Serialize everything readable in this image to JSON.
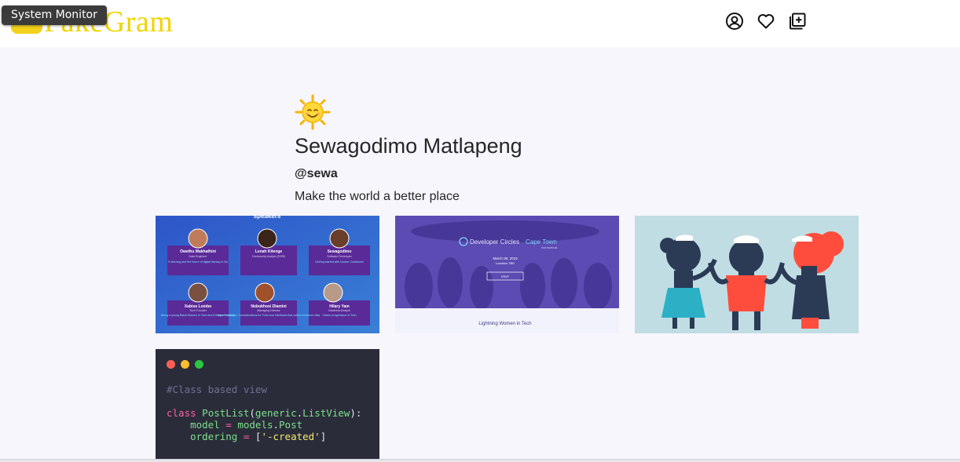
{
  "app": {
    "logo_text": "FakeGram",
    "tooltip": "System Monitor"
  },
  "nav": {
    "icons": [
      "user-circle-icon",
      "heart-icon",
      "add-post-icon"
    ]
  },
  "profile": {
    "avatar_icon": "sun-emoji-icon",
    "name": "Sewagodimo Matlapeng",
    "handle": "@sewa",
    "bio": "Make the world a better place"
  },
  "posts": {
    "speakers": {
      "heading": "speakers",
      "people": [
        {
          "name": "Owethu Makhathini",
          "role": "Data Engineer",
          "talk": "E-learning and the future of digital literacy in SA"
        },
        {
          "name": "Lenah Kitenge",
          "role": "Community Analyst (ESRI)",
          "talk": ""
        },
        {
          "name": "Sewagodimo",
          "role": "Software Developer",
          "talk": "Getting started with Docker Containers"
        },
        {
          "name": "Xabiso Lombo",
          "role": "Tech Founder",
          "talk": "Being a young Black Women in Tech and Entrepreneurship"
        },
        {
          "name": "Nobukhosi Dlamini",
          "role": "Managing Director",
          "talk": "Data Protection: Considerations for Trust and Interfaces that collect customer data"
        },
        {
          "name": "Hilary Yam",
          "role": "Business Analyst",
          "talk": "Career progression in Tech"
        }
      ]
    },
    "event": {
      "title_part1": "Developer Circles",
      "title_part2": "Cape Town",
      "subtitle": "from facebook",
      "date": "March 09, 2019",
      "location": "Location TBD",
      "button": "RSVP",
      "footer": "Lightning Women in Tech"
    },
    "code": {
      "comment": "#Class based view",
      "line1_kw": "class",
      "line1_cls": "PostList",
      "line1_arg": "generic",
      "line1_attr": "ListView",
      "line2_var": "model",
      "line2_obj": "models",
      "line2_attr": "Post",
      "line3_var": "ordering",
      "line3_val": "'-created'"
    }
  },
  "colors": {
    "logo": "#f0d400",
    "page_bg": "#f7f6fd",
    "speaker_bg": "#2f61c4",
    "speaker_card": "#5a2a98",
    "event_purple": "#5b4bb2",
    "nurse_bg": "#c0dde3",
    "code_bg": "#2b2c3a"
  }
}
